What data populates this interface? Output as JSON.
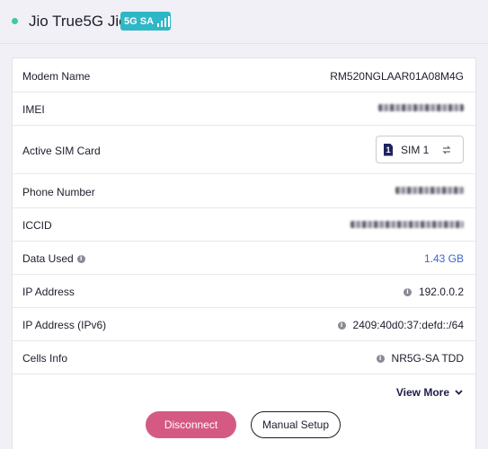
{
  "header": {
    "carrier_name": "Jio True5G Jio",
    "network_badge": "5G SA",
    "signal_bars": 4
  },
  "details": {
    "modem_name": {
      "label": "Modem Name",
      "value": "RM520NGLAAR01A08M4G"
    },
    "imei": {
      "label": "IMEI",
      "value_redacted": true
    },
    "active_sim": {
      "label": "Active SIM Card",
      "chip_number": "1",
      "value": "SIM 1"
    },
    "phone_number": {
      "label": "Phone Number",
      "value_redacted": true
    },
    "iccid": {
      "label": "ICCID",
      "value_redacted": true
    },
    "data_used": {
      "label": "Data Used",
      "value": "1.43 GB"
    },
    "ip_address": {
      "label": "IP Address",
      "value": "192.0.0.2"
    },
    "ipv6_address": {
      "label": "IP Address (IPv6)",
      "value": "2409:40d0:37:defd::/64"
    },
    "cells_info": {
      "label": "Cells Info",
      "value": "NR5G-SA TDD"
    }
  },
  "actions": {
    "view_more": "View More",
    "disconnect": "Disconnect",
    "manual_setup": "Manual Setup"
  },
  "colors": {
    "status_dot": "#3ec7a8",
    "badge": "#2fb7c6",
    "link": "#3d67c9",
    "disconnect": "#d45a84",
    "sim_chip": "#1f2260"
  }
}
